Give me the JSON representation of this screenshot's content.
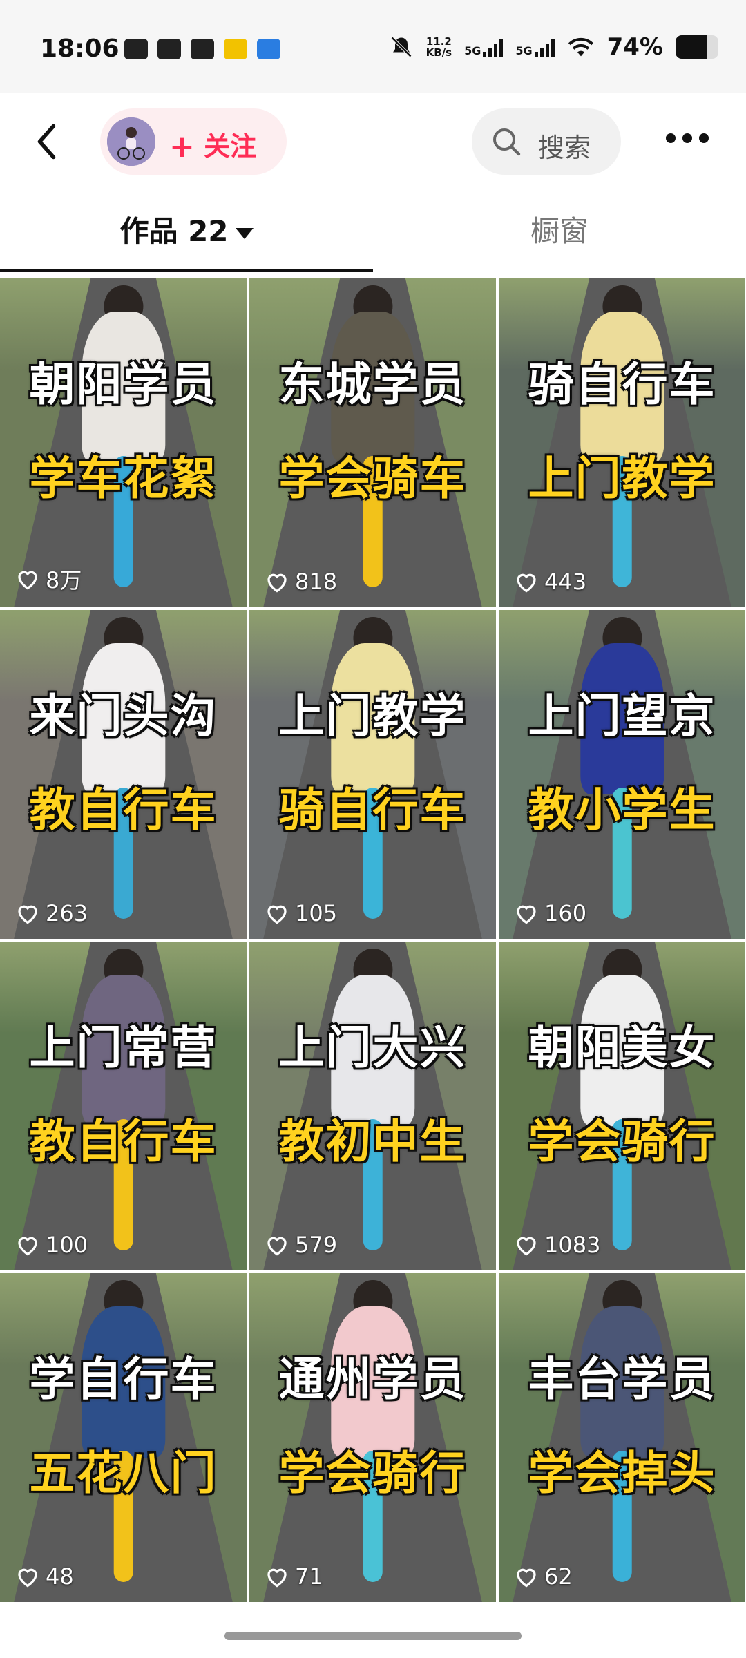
{
  "status_bar": {
    "time": "18:06",
    "net_speed_value": "11.2",
    "net_speed_unit": "KB/s",
    "signal1": "5G",
    "signal2": "5G",
    "battery_pct": "74%",
    "battery_level": 0.74
  },
  "header": {
    "follow_label": "关注",
    "search_label": "搜索"
  },
  "tabs": [
    {
      "label": "作品 22",
      "active": true
    },
    {
      "label": "橱窗",
      "active": false
    }
  ],
  "grid": [
    {
      "line1": "朝阳学员",
      "line2": "学车花絮",
      "likes": "8万"
    },
    {
      "line1": "东城学员",
      "line2": "学会骑车",
      "likes": "818"
    },
    {
      "line1": "骑自行车",
      "line2": "上门教学",
      "likes": "443"
    },
    {
      "line1": "来门头沟",
      "line2": "教自行车",
      "likes": "263"
    },
    {
      "line1": "上门教学",
      "line2": "骑自行车",
      "likes": "105"
    },
    {
      "line1": "上门望京",
      "line2": "教小学生",
      "likes": "160"
    },
    {
      "line1": "上门常营",
      "line2": "教自行车",
      "likes": "100"
    },
    {
      "line1": "上门大兴",
      "line2": "教初中生",
      "likes": "579"
    },
    {
      "line1": "朝阳美女",
      "line2": "学会骑行",
      "likes": "1083"
    },
    {
      "line1": "学自行车",
      "line2": "五花八门",
      "likes": "48"
    },
    {
      "line1": "通州学员",
      "line2": "学会骑行",
      "likes": "71"
    },
    {
      "line1": "丰台学员",
      "line2": "学会掉头",
      "likes": "62"
    }
  ]
}
